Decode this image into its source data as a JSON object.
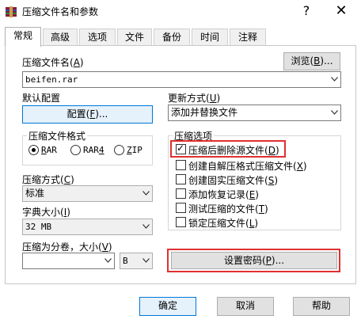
{
  "window": {
    "title": "压缩文件名和参数",
    "help": "?",
    "close": "✕"
  },
  "tabs": [
    {
      "label": "常规",
      "active": true
    },
    {
      "label": "高级"
    },
    {
      "label": "选项"
    },
    {
      "label": "文件"
    },
    {
      "label": "备份"
    },
    {
      "label": "时间"
    },
    {
      "label": "注释"
    }
  ],
  "archive_name": {
    "label": "压缩文件名(",
    "key": "A",
    "label_end": ")",
    "value": "beifen.rar",
    "browse_label": "浏览(",
    "browse_key": "B",
    "browse_end": ")..."
  },
  "profile": {
    "label": "默认配置",
    "button_label": "配置(",
    "button_key": "F",
    "button_end": ")..."
  },
  "update_mode": {
    "label": "更新方式(",
    "key": "U",
    "label_end": ")",
    "value": "添加并替换文件"
  },
  "format": {
    "title": "压缩文件格式",
    "options": [
      {
        "label": "RAR",
        "key": "R",
        "selected": true
      },
      {
        "label": "RAR4",
        "key": "R",
        "selected": false
      },
      {
        "label": "ZIP",
        "key": "Z",
        "selected": false
      }
    ]
  },
  "method": {
    "label": "压缩方式(",
    "key": "C",
    "label_end": ")",
    "value": "标准"
  },
  "dictionary": {
    "label": "字典大小(",
    "key": "I",
    "label_end": ")",
    "value": "32 MB"
  },
  "split": {
    "label": "压缩为分卷，大小(",
    "key": "V",
    "label_end": ")",
    "value": "",
    "unit": "B"
  },
  "options": {
    "title": "压缩选项",
    "items": [
      {
        "label": "压缩后删除源文件(",
        "key": "D",
        "end": ")",
        "checked": true
      },
      {
        "label": "创建自解压格式压缩文件(",
        "key": "X",
        "end": ")",
        "checked": false
      },
      {
        "label": "创建固实压缩文件(",
        "key": "S",
        "end": ")",
        "checked": false
      },
      {
        "label": "添加恢复记录(",
        "key": "E",
        "end": ")",
        "checked": false
      },
      {
        "label": "测试压缩的文件(",
        "key": "T",
        "end": ")",
        "checked": false
      },
      {
        "label": "锁定压缩文件(",
        "key": "L",
        "end": ")",
        "checked": false
      }
    ]
  },
  "password": {
    "label": "设置密码(",
    "key": "P",
    "end": ")..."
  },
  "footer": {
    "ok": "确定",
    "cancel": "取消",
    "help": "帮助"
  },
  "colors": {
    "highlight": "#e03030",
    "focus_border": "#0078d7"
  }
}
